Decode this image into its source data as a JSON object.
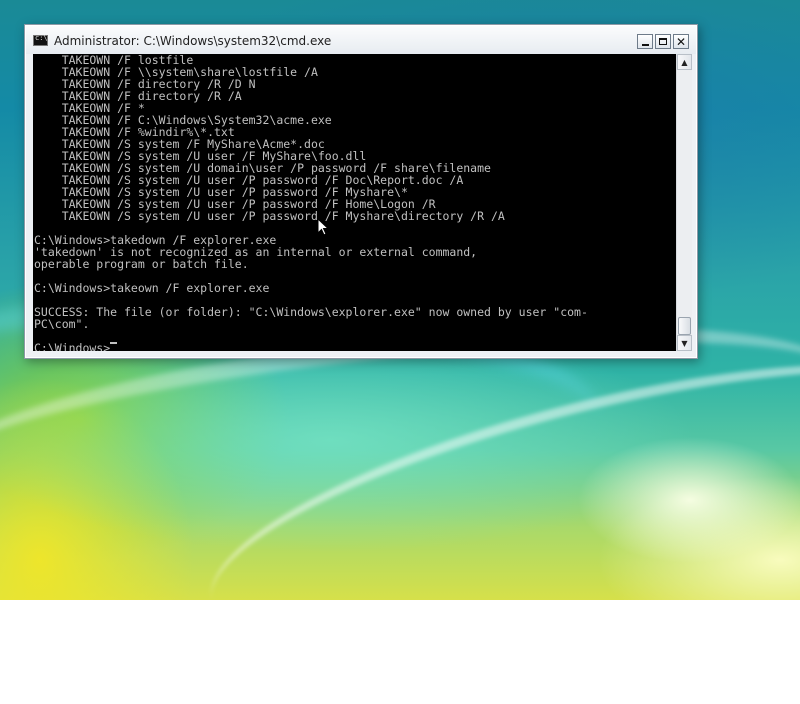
{
  "window": {
    "title": "Administrator: C:\\Windows\\system32\\cmd.exe",
    "icon": "cmd-icon",
    "buttons": {
      "minimize": "minimize-icon",
      "maximize": "maximize-icon",
      "close": "close-icon",
      "close_glyph": "✕"
    }
  },
  "console": {
    "lines": [
      "    TAKEOWN /F lostfile",
      "    TAKEOWN /F \\\\system\\share\\lostfile /A",
      "    TAKEOWN /F directory /R /D N",
      "    TAKEOWN /F directory /R /A",
      "    TAKEOWN /F *",
      "    TAKEOWN /F C:\\Windows\\System32\\acme.exe",
      "    TAKEOWN /F %windir%\\*.txt",
      "    TAKEOWN /S system /F MyShare\\Acme*.doc",
      "    TAKEOWN /S system /U user /F MyShare\\foo.dll",
      "    TAKEOWN /S system /U domain\\user /P password /F share\\filename",
      "    TAKEOWN /S system /U user /P password /F Doc\\Report.doc /A",
      "    TAKEOWN /S system /U user /P password /F Myshare\\*",
      "    TAKEOWN /S system /U user /P password /F Home\\Logon /R",
      "    TAKEOWN /S system /U user /P password /F Myshare\\directory /R /A",
      "",
      "C:\\Windows>takedown /F explorer.exe",
      "'takedown' is not recognized as an internal or external command,",
      "operable program or batch file.",
      "",
      "C:\\Windows>takeown /F explorer.exe",
      "",
      "SUCCESS: The file (or folder): \"C:\\Windows\\explorer.exe\" now owned by user \"com-",
      "PC\\com\".",
      ""
    ],
    "prompt": "C:\\Windows>",
    "text_color": "#c0c0c0",
    "background": "#000000"
  },
  "scrollbar": {
    "up_glyph": "▲",
    "down_glyph": "▼"
  }
}
